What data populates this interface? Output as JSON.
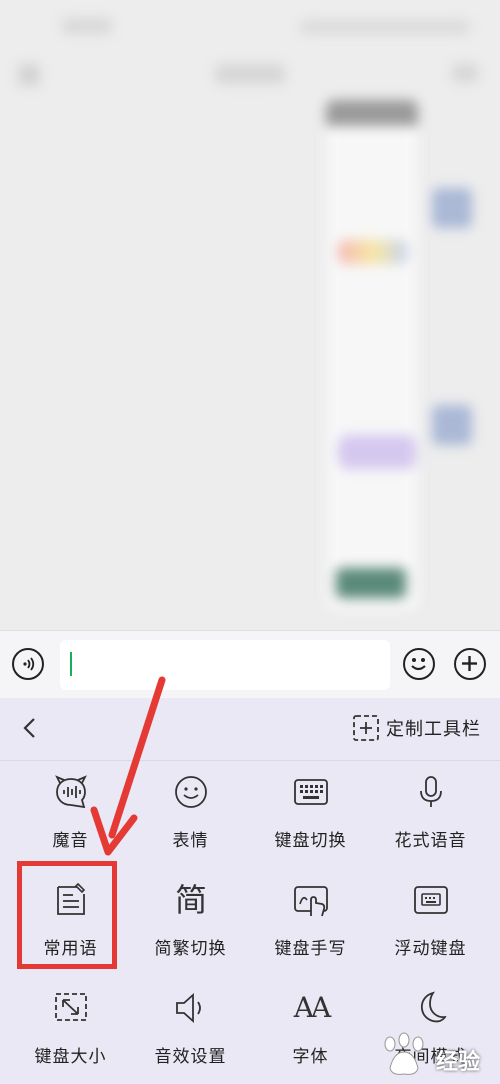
{
  "keyboard": {
    "custom_toolbar_label": "定制工具栏",
    "tools": [
      {
        "label": "魔音",
        "icon": "devil-wave-icon"
      },
      {
        "label": "表情",
        "icon": "smiley-icon"
      },
      {
        "label": "键盘切换",
        "icon": "keyboard-icon"
      },
      {
        "label": "花式语音",
        "icon": "microphone-icon"
      },
      {
        "label": "常用语",
        "icon": "note-pen-icon"
      },
      {
        "label": "简繁切换",
        "icon": "jian-character-icon"
      },
      {
        "label": "键盘手写",
        "icon": "handwriting-icon"
      },
      {
        "label": "浮动键盘",
        "icon": "floating-keyboard-icon"
      },
      {
        "label": "键盘大小",
        "icon": "resize-icon"
      },
      {
        "label": "音效设置",
        "icon": "speaker-icon"
      },
      {
        "label": "字体",
        "icon": "font-icon"
      },
      {
        "label": "夜间模式",
        "icon": "moon-icon"
      }
    ]
  },
  "icon_glyph": {
    "jian": "简",
    "font": "AA"
  },
  "watermark": {
    "text": "经验"
  },
  "colors": {
    "highlight": "#e53935",
    "caret": "#1aad5b",
    "keyboard_bg": "#e9e8f4"
  }
}
